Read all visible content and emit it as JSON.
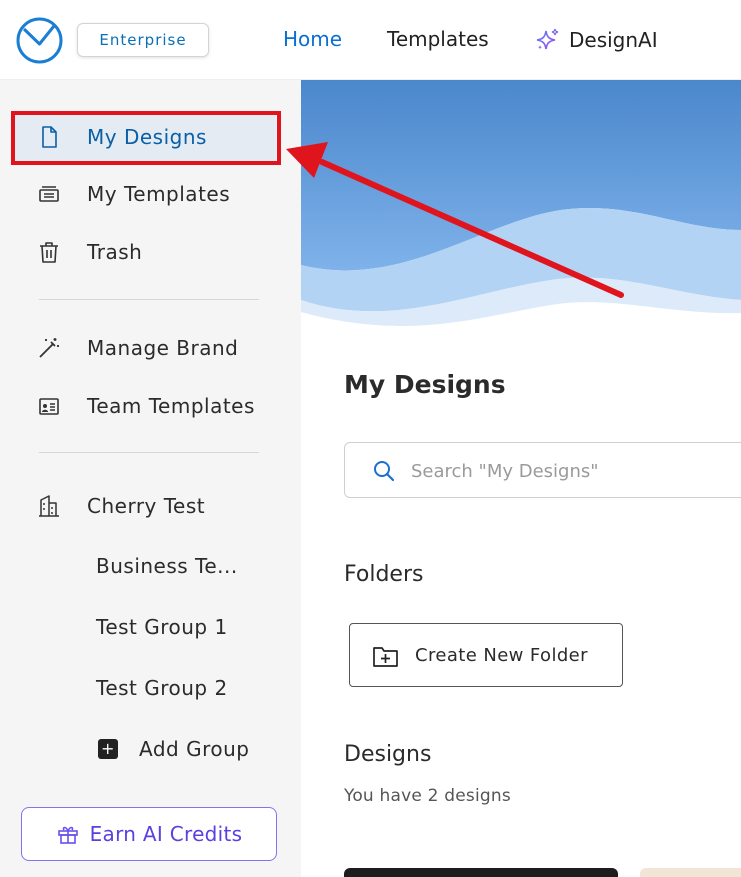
{
  "header": {
    "badge": "Enterprise",
    "nav": {
      "home": "Home",
      "templates": "Templates",
      "design_ai": "DesignAI"
    }
  },
  "sidebar": {
    "primary": [
      {
        "label": "My Designs",
        "icon": "file-icon",
        "active": true
      },
      {
        "label": "My Templates",
        "icon": "templates-icon"
      },
      {
        "label": "Trash",
        "icon": "trash-icon"
      }
    ],
    "brand": [
      {
        "label": "Manage Brand",
        "icon": "magic-wand-icon"
      },
      {
        "label": "Team Templates",
        "icon": "team-templates-icon"
      }
    ],
    "workspace": {
      "label": "Cherry Test",
      "icon": "building-icon"
    },
    "groups": [
      "Business Te...",
      "Test Group 1",
      "Test Group 2"
    ],
    "add_group": "Add Group",
    "earn_credits": "Earn AI Credits"
  },
  "main": {
    "title": "My Designs",
    "search_placeholder": "Search \"My Designs\"",
    "folders_heading": "Folders",
    "create_folder": "Create New Folder",
    "designs_heading": "Designs",
    "designs_count": "You have 2 designs"
  },
  "colors": {
    "accent": "#0a6fd1",
    "highlight_annotation": "#e0141c",
    "earn_purple": "#5b3fe0"
  }
}
